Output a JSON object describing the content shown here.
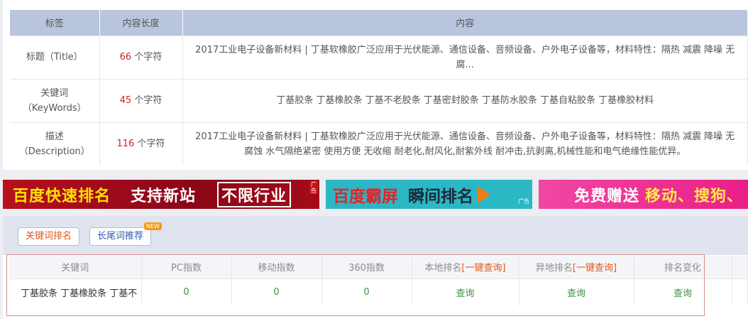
{
  "meta_table": {
    "headers": [
      "标签",
      "内容长度",
      "内容"
    ],
    "rows": [
      {
        "label_line1": "标题（Title）",
        "label_line2": "",
        "count": "66",
        "unit": "个字符",
        "content": "2017工业电子设备新材料 | 丁基软橡胶广泛应用于光伏能源、通信设备、音频设备、户外电子设备等，材料特性：隔热 减震 降噪 无腐..."
      },
      {
        "label_line1": "关键词",
        "label_line2": "（KeyWords）",
        "count": "45",
        "unit": "个字符",
        "content": "丁基胶条 丁基橡胶条 丁基不老胶条 丁基密封胶条 丁基防水胶条 丁基自粘胶条 丁基橡胶材料"
      },
      {
        "label_line1": "描述",
        "label_line2": "（Description）",
        "count": "116",
        "unit": "个字符",
        "content": "2017工业电子设备新材料 | 丁基软橡胶广泛应用于光伏能源、通信设备、音频设备、户外电子设备等，材料特性：隔热 减震 降噪 无腐蚀 水气隔绝紧密 使用方便 无收缩 耐老化,耐风化,耐紫外线 耐冲击,抗剥离,机械性能和电气绝缘性能优异。"
      }
    ]
  },
  "ads": {
    "ad1": {
      "part1": "百度快速排名",
      "part2": "支持新站",
      "part3": "不限行业",
      "tag": "广告"
    },
    "ad2": {
      "part1": "百度霸屏",
      "part2": "瞬间排名",
      "tag": "广告"
    },
    "ad3": {
      "part1": "免费赠送",
      "part2": "移动、搜狗、"
    }
  },
  "tabs": {
    "keyword_rank": "关键词排名",
    "longtail": "长尾词推荐",
    "new_badge": "NEW"
  },
  "rank_table": {
    "headers": {
      "keyword": "关键词",
      "pc": "PC指数",
      "mobile": "移动指数",
      "s360": "360指数",
      "local": "本地排名",
      "local_link": "[一键查询]",
      "remote": "异地排名",
      "remote_link": "[一键查询]",
      "change": "排名变化"
    },
    "row": {
      "keyword": "丁基胶条 丁基橡胶条 丁基不",
      "pc": "0",
      "mobile": "0",
      "s360": "0",
      "local": "查询",
      "remote": "查询",
      "change": "查询"
    }
  },
  "colors": {
    "header_bg": "#b9c5dd",
    "accent_red": "#d62222",
    "accent_orange": "#e2561b",
    "link_green": "#2e8b2e"
  }
}
